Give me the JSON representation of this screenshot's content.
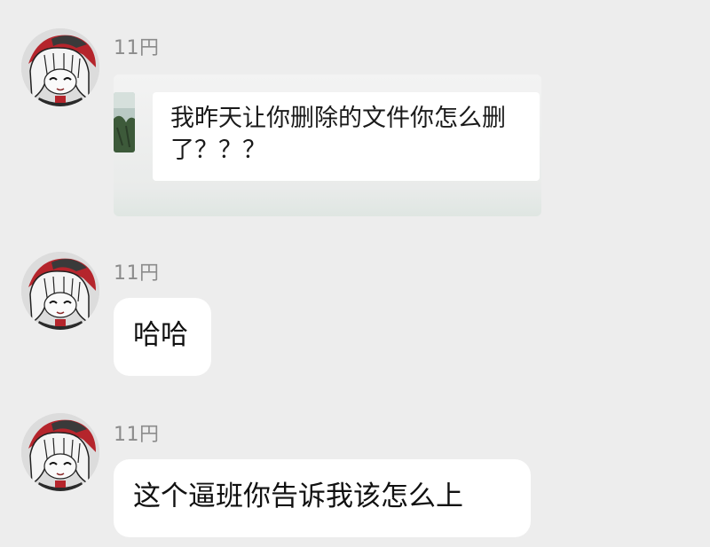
{
  "messages": [
    {
      "sender": "11円",
      "avatar": "anime-girl-avatar-icon",
      "type": "quote",
      "text": "我昨天让你删除的文件你怎么删了？？？"
    },
    {
      "sender": "11円",
      "avatar": "anime-girl-avatar-icon",
      "type": "text",
      "text": "哈哈"
    },
    {
      "sender": "11円",
      "avatar": "anime-girl-avatar-icon",
      "type": "text",
      "text": "这个逼班你告诉我该怎么上"
    }
  ],
  "colors": {
    "background": "#ededed",
    "bubble": "#ffffff",
    "sender_name": "#8c8c8c",
    "text": "#111111"
  }
}
